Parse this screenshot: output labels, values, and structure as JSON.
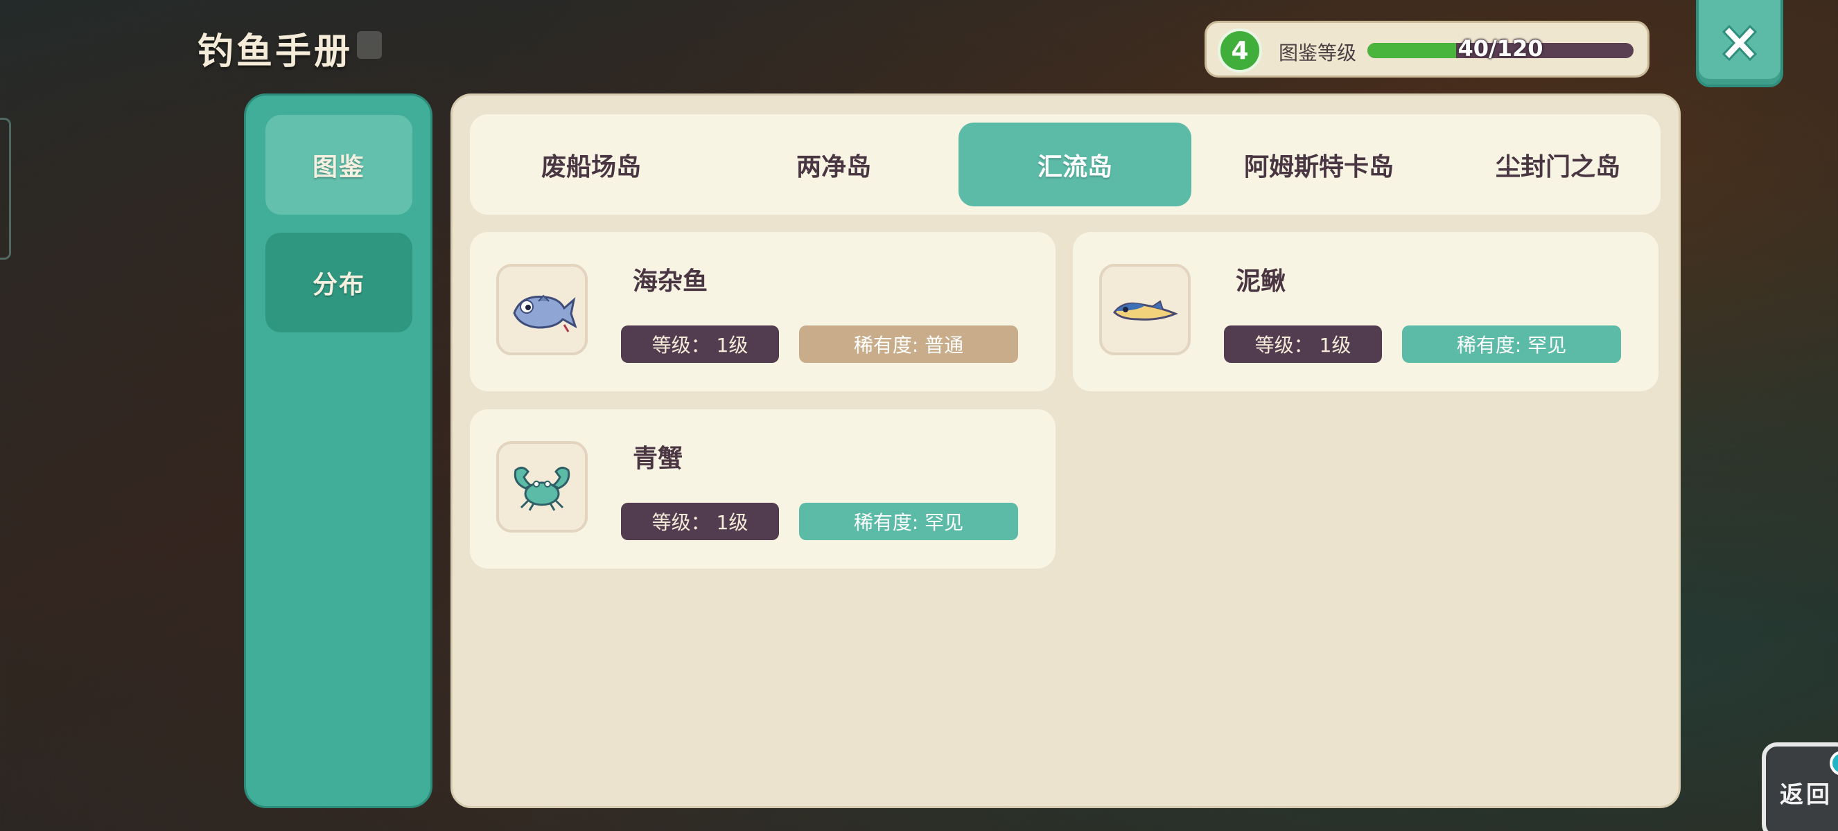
{
  "page": {
    "title": "钓鱼手册"
  },
  "level": {
    "value": "4",
    "label": "图鉴等级",
    "progress_text": "40/120",
    "progress_fraction": 0.333
  },
  "sidebar": {
    "items": [
      {
        "label": "图鉴"
      },
      {
        "label": "分布"
      }
    ]
  },
  "tabs": [
    {
      "label": "废船场岛"
    },
    {
      "label": "两净岛"
    },
    {
      "label": "汇流岛"
    },
    {
      "label": "阿姆斯特卡岛"
    },
    {
      "label": "尘封门之岛"
    }
  ],
  "fish": [
    {
      "name": "海杂鱼",
      "level": "等级：  1级",
      "rarity": "稀有度: 普通",
      "icon": "fish-icon"
    },
    {
      "name": "泥鳅",
      "level": "等级：  1级",
      "rarity": "稀有度: 罕见",
      "icon": "loach-icon"
    },
    {
      "name": "青蟹",
      "level": "等级：  1级",
      "rarity": "稀有度: 罕见",
      "icon": "crab-icon"
    }
  ],
  "back": {
    "label": "返回"
  },
  "colors": {
    "accent": "#5cbba7",
    "sidebar": "#40ae98",
    "panel": "#ebe3cd",
    "level_green": "#3fae3a",
    "tag_dark": "#523c50",
    "tag_common": "#c9ad8b"
  }
}
